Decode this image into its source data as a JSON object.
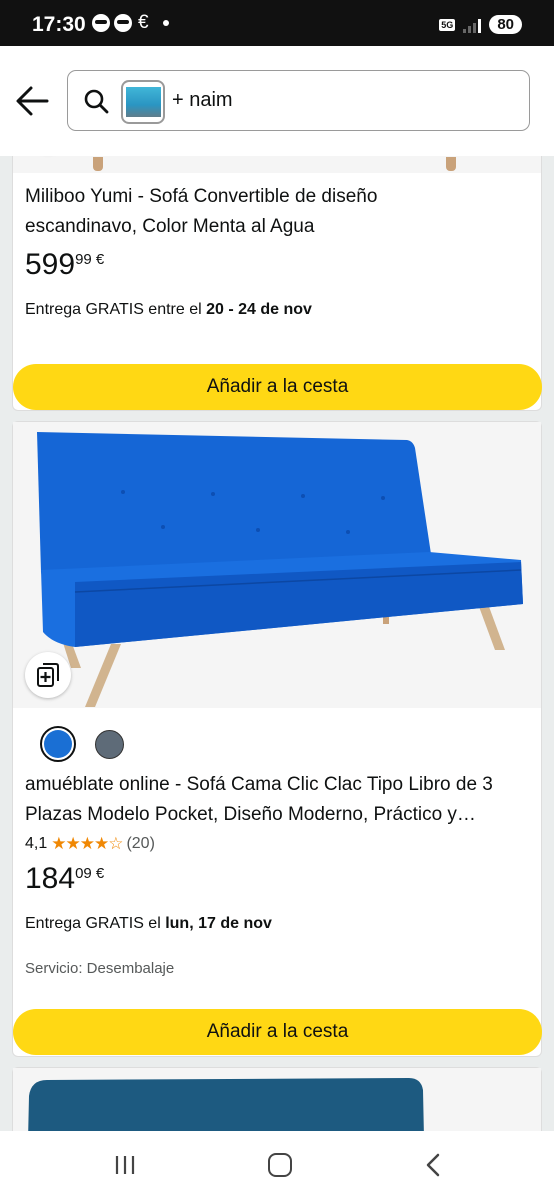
{
  "status_bar": {
    "time": "17:30",
    "network": "5G",
    "battery": "80"
  },
  "search": {
    "query_text": "+ naim"
  },
  "products": [
    {
      "title_line1": "Miliboo Yumi - Sofá Convertible de diseño",
      "title_line2": "escandinavo, Color Menta al Agua",
      "price_int": "599",
      "price_dec": "99 €",
      "delivery_prefix": "Entrega GRATIS entre el ",
      "delivery_date": "20 - 24 de nov",
      "add_button": "Añadir a la cesta"
    },
    {
      "title_line1": "amuéblate online - Sofá Cama Clic Clac Tipo Libro de 3",
      "title_line2": "Plazas Modelo Pocket, Diseño Moderno, Práctico y…",
      "swatch_colors": [
        "#1a6fd4",
        "#5e6b78"
      ],
      "rating_value": "4,1",
      "rating": 4.1,
      "stars": "★★★★☆",
      "rating_count": "(20)",
      "price_int": "184",
      "price_dec": "09 €",
      "delivery_prefix": "Entrega GRATIS el ",
      "delivery_date": "lun, 17 de nov",
      "service": "Servicio: Desembalaje",
      "add_button": "Añadir a la cesta"
    }
  ],
  "icons": {
    "back": "arrow-left-icon",
    "search": "search-icon",
    "compare": "compare-add-icon",
    "nav_recents": "recents-icon",
    "nav_home": "home-icon",
    "nav_back": "back-chevron-icon"
  },
  "colors": {
    "add_button": "#ffd814",
    "stars": "#f08804",
    "page_background": "#eaeded"
  }
}
